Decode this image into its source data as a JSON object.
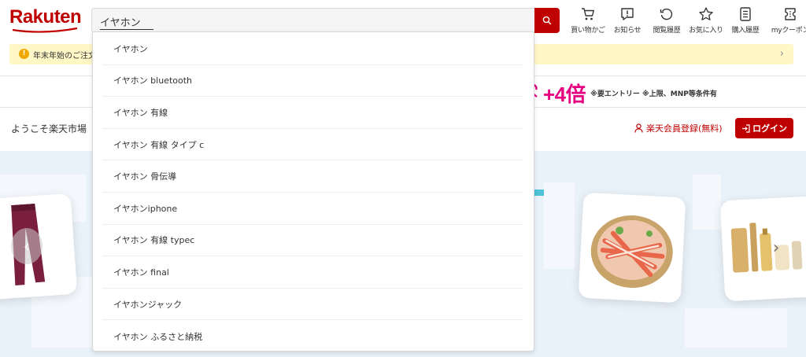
{
  "header": {
    "logo_text": "Rakuten",
    "search_value": "イヤホン",
    "icons": [
      {
        "name": "cart-icon",
        "label": "買い物かご"
      },
      {
        "name": "notification-icon",
        "label": "お知らせ"
      },
      {
        "name": "history-icon",
        "label": "閲覧履歴"
      },
      {
        "name": "star-icon",
        "label": "お気に入り"
      },
      {
        "name": "receipt-icon",
        "label": "購入履歴"
      },
      {
        "name": "coupon-icon",
        "label": "myクーポン"
      }
    ]
  },
  "notice": {
    "text": "年末年始のご注文"
  },
  "promo": {
    "big_text": "+4倍",
    "note": "※要エントリー ※上限、MNP等条件有"
  },
  "welcome": {
    "text": "ようこそ楽天市場",
    "register_label": "楽天会員登録(無料)",
    "login_label": "ログイン"
  },
  "suggestions": [
    "イヤホン",
    "イヤホン bluetooth",
    "イヤホン 有線",
    "イヤホン 有線 タイプ c",
    "イヤホン 骨伝導",
    "イヤホンiphone",
    "イヤホン 有線 typec",
    "イヤホン final",
    "イヤホンジャック",
    "イヤホン ふるさと納税"
  ],
  "colors": {
    "brand_red": "#bf0000",
    "promo_pink": "#e5007f",
    "notice_bg": "#fff7c6"
  }
}
